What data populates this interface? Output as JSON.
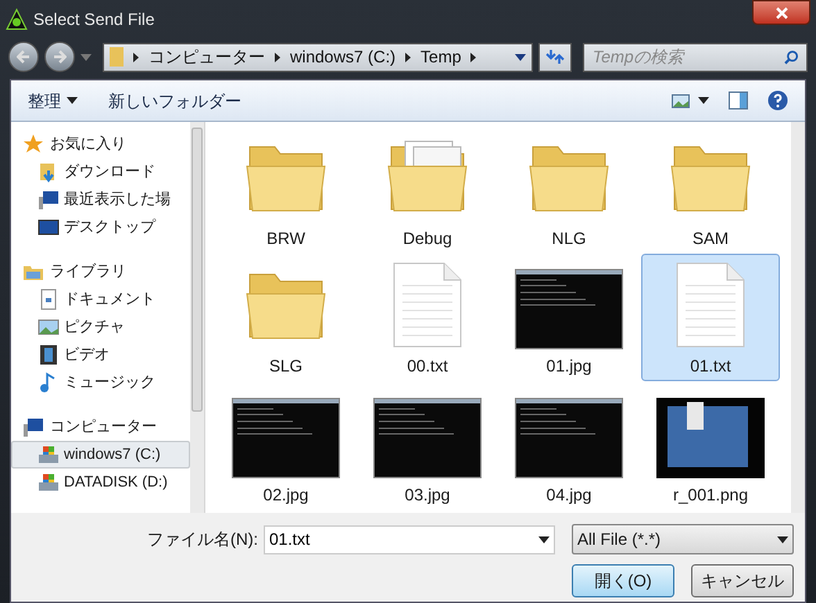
{
  "window": {
    "title": "Select Send File"
  },
  "address": {
    "segments": [
      "コンピューター",
      "windows7 (C:)",
      "Temp"
    ]
  },
  "search": {
    "placeholder": "Tempの検索"
  },
  "toolbar": {
    "organize": "整理",
    "new_folder": "新しいフォルダー"
  },
  "sidebar": {
    "groups": [
      {
        "label": "お気に入り",
        "children": [
          {
            "label": "ダウンロード",
            "selected": false
          },
          {
            "label": "最近表示した場",
            "selected": false
          },
          {
            "label": "デスクトップ",
            "selected": false
          }
        ]
      },
      {
        "label": "ライブラリ",
        "children": [
          {
            "label": "ドキュメント",
            "selected": false
          },
          {
            "label": "ピクチャ",
            "selected": false
          },
          {
            "label": "ビデオ",
            "selected": false
          },
          {
            "label": "ミュージック",
            "selected": false
          }
        ]
      },
      {
        "label": "コンピューター",
        "children": [
          {
            "label": "windows7 (C:)",
            "selected": true
          },
          {
            "label": "DATADISK (D:)",
            "selected": false
          }
        ]
      }
    ]
  },
  "files": [
    {
      "name": "BRW",
      "kind": "folder",
      "selected": false
    },
    {
      "name": "Debug",
      "kind": "folder-docs",
      "selected": false
    },
    {
      "name": "NLG",
      "kind": "folder",
      "selected": false
    },
    {
      "name": "SAM",
      "kind": "folder",
      "selected": false
    },
    {
      "name": "SLG",
      "kind": "folder",
      "selected": false
    },
    {
      "name": "00.txt",
      "kind": "text",
      "selected": false
    },
    {
      "name": "01.jpg",
      "kind": "console",
      "selected": false
    },
    {
      "name": "01.txt",
      "kind": "text",
      "selected": true
    },
    {
      "name": "02.jpg",
      "kind": "console",
      "selected": false
    },
    {
      "name": "03.jpg",
      "kind": "console",
      "selected": false
    },
    {
      "name": "04.jpg",
      "kind": "console",
      "selected": false
    },
    {
      "name": "r_001.png",
      "kind": "desktop",
      "selected": false
    }
  ],
  "filename": {
    "label": "ファイル名(N):",
    "value": "01.txt"
  },
  "filetype": {
    "value": "All File (*.*)"
  },
  "buttons": {
    "open": "開く(O)",
    "cancel": "キャンセル"
  }
}
